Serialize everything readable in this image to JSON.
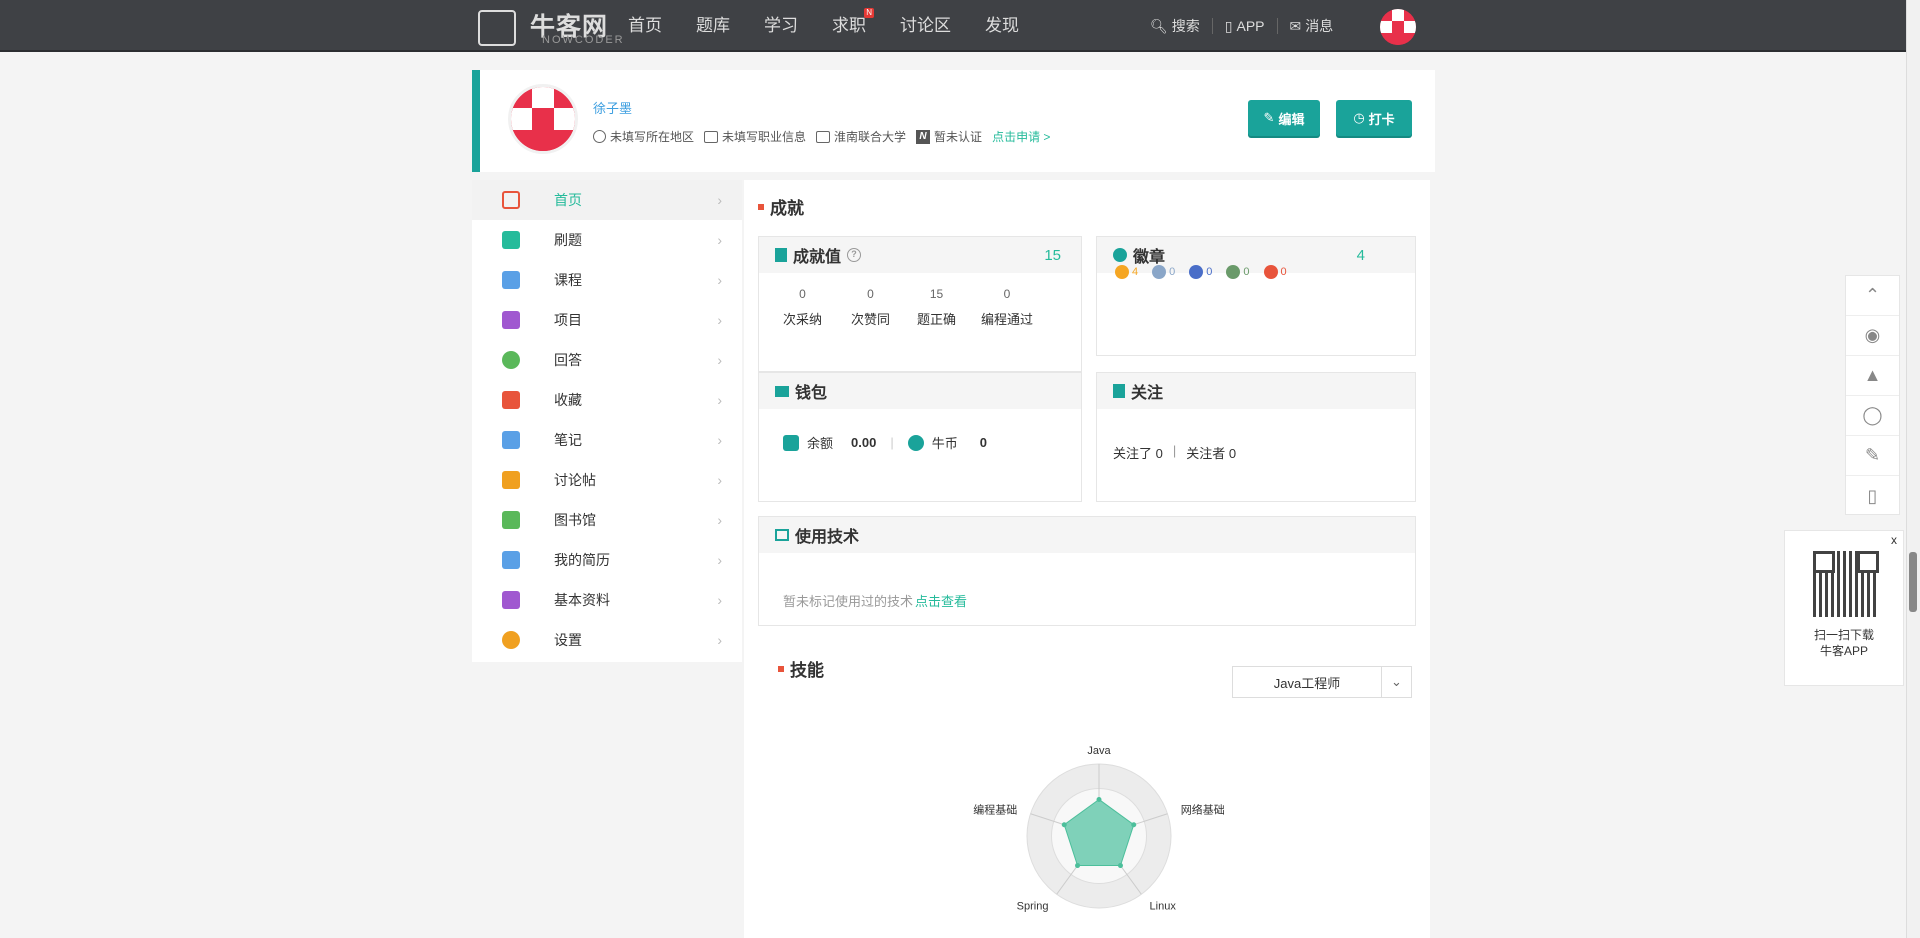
{
  "topnav": {
    "logo": {
      "brand": "牛客网",
      "sub": "NOWCODER"
    },
    "items": [
      {
        "label": "首页"
      },
      {
        "label": "题库"
      },
      {
        "label": "学习"
      },
      {
        "label": "求职",
        "badge": "N"
      },
      {
        "label": "讨论区"
      },
      {
        "label": "发现"
      }
    ],
    "search": "搜索",
    "app": "APP",
    "messages": "消息"
  },
  "profile": {
    "name": "徐子墨",
    "region": "未填写所在地区",
    "job": "未填写职业信息",
    "school": "淮南联合大学",
    "auth": "暂未认证",
    "apply": "点击申请 >",
    "edit": "编辑",
    "checkin": "打卡"
  },
  "sidebar": {
    "items": [
      {
        "label": "首页",
        "color": "#e8543b"
      },
      {
        "label": "刷题",
        "color": "#25bb9b"
      },
      {
        "label": "课程",
        "color": "#5aa0e6"
      },
      {
        "label": "项目",
        "color": "#a058d0"
      },
      {
        "label": "回答",
        "color": "#5ab85a"
      },
      {
        "label": "收藏",
        "color": "#e8543b"
      },
      {
        "label": "笔记",
        "color": "#5aa0e6"
      },
      {
        "label": "讨论帖",
        "color": "#f0a020"
      },
      {
        "label": "图书馆",
        "color": "#5ab85a"
      },
      {
        "label": "我的简历",
        "color": "#5aa0e6"
      },
      {
        "label": "基本资料",
        "color": "#a058d0"
      },
      {
        "label": "设置",
        "color": "#f0a020"
      }
    ]
  },
  "achievement": {
    "title": "成就",
    "score_title": "成就值",
    "score": "15",
    "stats": [
      {
        "value": "0",
        "label": "次采纳"
      },
      {
        "value": "0",
        "label": "次赞同"
      },
      {
        "value": "15",
        "label": "题正确"
      },
      {
        "value": "0",
        "label": "编程通过"
      }
    ],
    "badge_title": "徽章",
    "badge_count": "4",
    "badges": [
      {
        "value": "4",
        "color": "#f5a623"
      },
      {
        "value": "0",
        "color": "#8aa6c8"
      },
      {
        "value": "0",
        "color": "#4a6ec8"
      },
      {
        "value": "0",
        "color": "#6a9a6a"
      },
      {
        "value": "0",
        "color": "#e8543b"
      }
    ],
    "wallet_title": "钱包",
    "balance_label": "余额",
    "balance": "0.00",
    "coin_label": "牛币",
    "coin": "0",
    "follow_title": "关注",
    "following": "关注了 0",
    "followers": "关注者 0",
    "tech_title": "使用技术",
    "tech_empty": "暂未标记使用过的技术",
    "tech_link": "点击查看"
  },
  "skills": {
    "title": "技能",
    "selected": "Java工程师",
    "radar_labels": [
      "Java",
      "网络基础",
      "Linux",
      "Spring",
      "编程基础"
    ],
    "radar_values": [
      0.35,
      0.35,
      0.35,
      0.35,
      0.35
    ]
  },
  "float": {
    "qr_close": "x",
    "qr_text1": "扫一扫下载",
    "qr_text2": "牛客APP"
  }
}
